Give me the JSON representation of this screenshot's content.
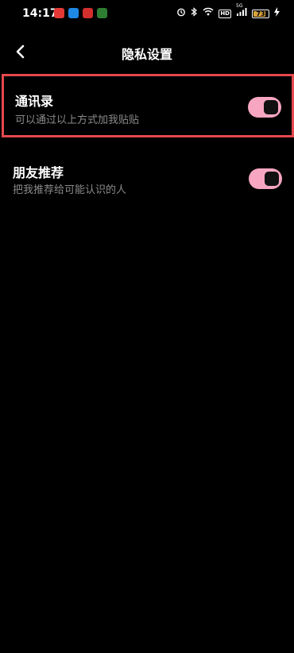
{
  "status_bar": {
    "time": "14:17",
    "app_icons": [
      "app-icon-1",
      "app-icon-2",
      "app-icon-3",
      "app-icon-4"
    ],
    "icons": [
      "alarm-icon",
      "bluetooth-icon",
      "wifi-icon",
      "hd-icon",
      "signal-icon",
      "battery-icon",
      "charging-icon"
    ],
    "hd_label": "HD",
    "network_label": "5G",
    "battery_level": "73"
  },
  "header": {
    "title": "隐私设置",
    "back_icon": "chevron-left-icon"
  },
  "settings": [
    {
      "title": "通讯录",
      "description": "可以通过以上方式加我贴贴",
      "enabled": true,
      "highlighted": true
    },
    {
      "title": "朋友推荐",
      "description": "把我推荐给可能认识的人",
      "enabled": true,
      "highlighted": false
    }
  ],
  "colors": {
    "background": "#000000",
    "toggle_on": "#f7a6c2",
    "highlight_border": "#e5484d",
    "secondary_text": "#8a8a8a"
  }
}
